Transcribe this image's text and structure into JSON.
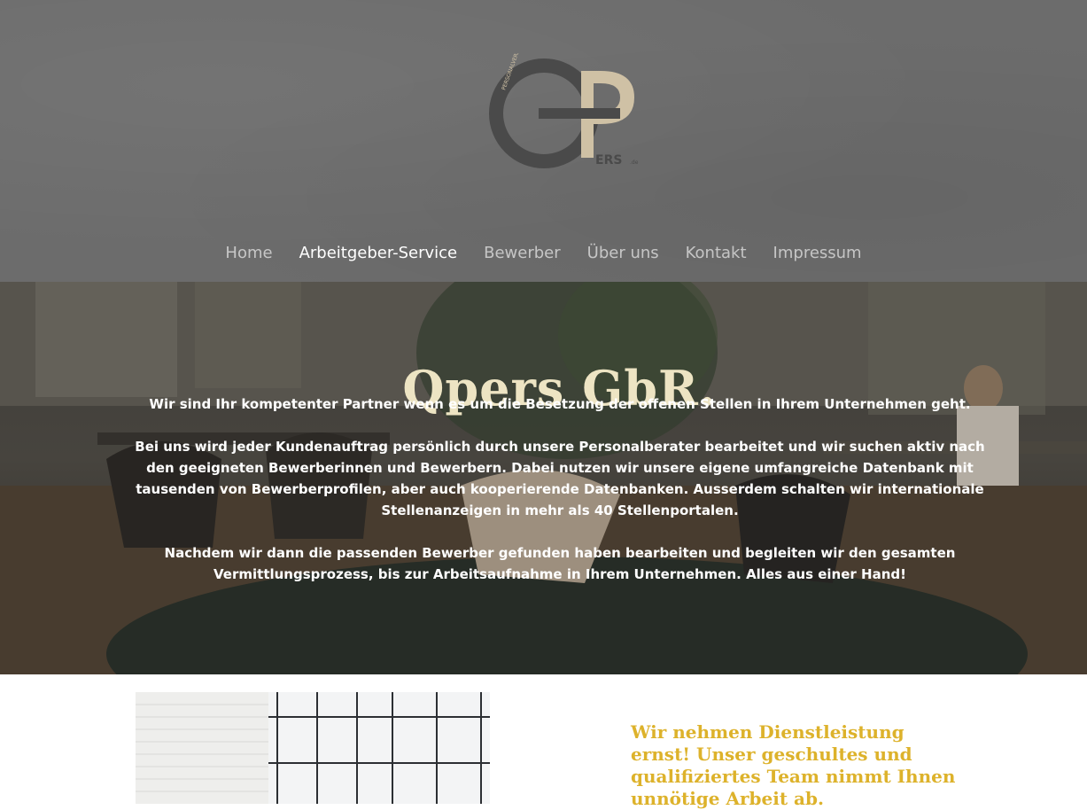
{
  "header": {
    "logo": {
      "letters": "Q",
      "p_letter": "P",
      "ers": "ERS",
      "suffix": ".de",
      "ring_text": "PERSONALVERMITTLUNG",
      "colors": {
        "dark": "#4a4a4a",
        "light": "#cfc1a5"
      }
    },
    "nav": {
      "items": [
        {
          "label": "Home",
          "active": false
        },
        {
          "label": "Arbeitgeber-Service",
          "active": true
        },
        {
          "label": "Bewerber",
          "active": false
        },
        {
          "label": "Über uns",
          "active": false
        },
        {
          "label": "Kontakt",
          "active": false
        },
        {
          "label": "Impressum",
          "active": false
        }
      ]
    }
  },
  "hero": {
    "title": "Qpers GbR.",
    "paragraphs": [
      "Wir sind Ihr kompetenter Partner wenn es um die Besetzung der offenen Stellen in Ihrem Unternehmen geht.",
      "Bei uns wird jeder Kundenauftrag persönlich durch unsere Personalberater bearbeitet und wir suchen aktiv nach den geeigneten Bewerberinnen und Bewerbern. Dabei nutzen wir unsere eigene umfangreiche Datenbank mit tausenden von Bewerberprofilen, aber auch kooperierende Datenbanken. Ausserdem schalten wir internationale Stellenanzeigen in mehr als 40 Stellenportalen.",
      "Nachdem wir dann die passenden Bewerber gefunden haben bearbeiten und begleiten wir den gesamten Vermittlungsprozess, bis zur Arbeitsaufnahme in Ihrem Unternehmen. Alles aus einer Hand!"
    ],
    "colors": {
      "title": "#ede4c3",
      "text": "#ffffff"
    }
  },
  "content": {
    "heading": "Wir nehmen Dienstleistung ernst! Unser geschultes und qualifiziertes Team nimmt Ihnen unnötige Arbeit ab.",
    "heading_color": "#ddb22b"
  }
}
